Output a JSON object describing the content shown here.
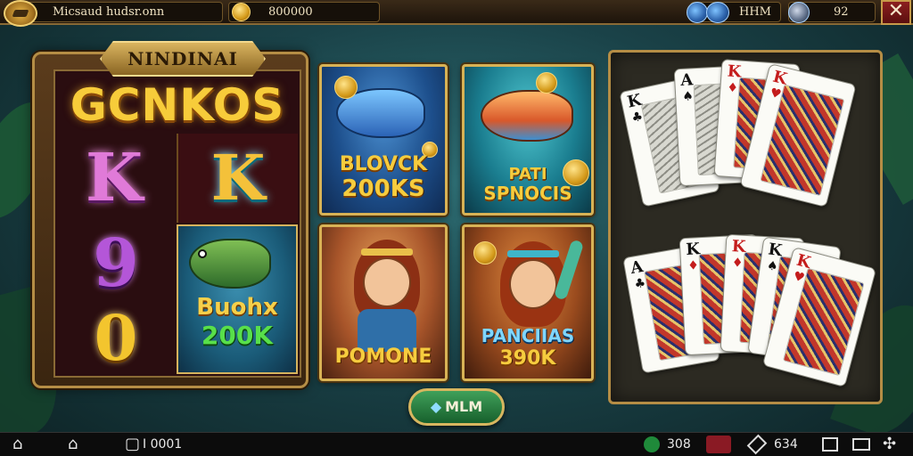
{
  "topbar": {
    "title": "Micsaud hudsr.onn",
    "coins": "800000",
    "level_label": "HHM",
    "second_value": "92",
    "close": "✕"
  },
  "slot": {
    "plate_title": "NINDINAI",
    "game_title": "GCNKOS",
    "symbols": [
      "K",
      "K",
      "9",
      "0"
    ],
    "fish_tile_label_1": "Buohx",
    "fish_tile_label_2": "200K"
  },
  "tiles": [
    {
      "line1": "BLOVCK",
      "line2": "200KS"
    },
    {
      "line1": "PATI",
      "line2": "SPNOCIS"
    },
    {
      "line1": "POMONE",
      "line2": ""
    },
    {
      "line1": "PANCIIAS",
      "line2": "390K"
    }
  ],
  "cards": {
    "top": [
      {
        "rank": "K",
        "suit": "♣",
        "color": "black"
      },
      {
        "rank": "A",
        "suit": "♠",
        "color": "black"
      },
      {
        "rank": "K",
        "suit": "♦",
        "color": "red"
      },
      {
        "rank": "K",
        "suit": "♥",
        "color": "red"
      }
    ],
    "bottom": [
      {
        "rank": "A",
        "suit": "♣",
        "color": "black"
      },
      {
        "rank": "K",
        "suit": "♦",
        "color": "red"
      },
      {
        "rank": "K",
        "suit": "♦",
        "color": "red"
      },
      {
        "rank": "K",
        "suit": "♠",
        "color": "black"
      },
      {
        "rank": "K",
        "suit": "♥",
        "color": "red"
      }
    ]
  },
  "play_button": {
    "label": "MLM",
    "icon": "diamond-icon"
  },
  "bottombar": {
    "home_icon": "⌂",
    "home2_icon": "⌂",
    "counter_icon": "▢",
    "counter": "I 0001",
    "stat1": "308",
    "stat2": "634"
  },
  "colors": {
    "gold": "#d8b255",
    "background": "#1a4248",
    "play_green": "#17602c",
    "close_red": "#8c1f1f"
  }
}
